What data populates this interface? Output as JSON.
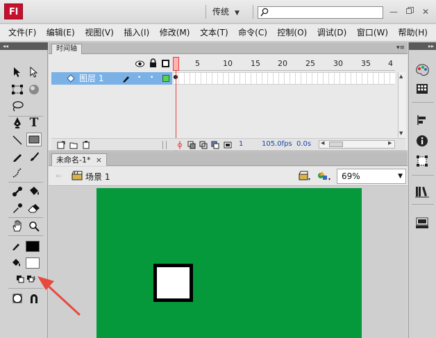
{
  "app": {
    "logo_text": "Fl",
    "workspace": "传统",
    "search": {
      "placeholder": "",
      "value": ""
    },
    "window_controls": [
      "minimize-icon",
      "restore-icon",
      "close-icon"
    ]
  },
  "menu": {
    "items": [
      {
        "label": "文件(F)"
      },
      {
        "label": "编辑(E)"
      },
      {
        "label": "视图(V)"
      },
      {
        "label": "插入(I)"
      },
      {
        "label": "修改(M)"
      },
      {
        "label": "文本(T)"
      },
      {
        "label": "命令(C)"
      },
      {
        "label": "控制(O)"
      },
      {
        "label": "调试(D)"
      },
      {
        "label": "窗口(W)"
      },
      {
        "label": "帮助(H)"
      }
    ]
  },
  "timeline": {
    "tab_label": "时间轴",
    "layer": {
      "name": "图层 1"
    },
    "frame_numbers": [
      "1",
      "5",
      "10",
      "15",
      "20",
      "25",
      "30",
      "35",
      "4"
    ],
    "current_frame": "1",
    "fps": "105.0fps",
    "elapsed": "0.0s"
  },
  "document": {
    "tab_title": "未命名-1*",
    "close_glyph": "×",
    "scene": "场景 1",
    "zoom": "69%"
  },
  "stage": {
    "background_color": "#05993b",
    "shape": {
      "fill": "#ffffff",
      "stroke": "#000000"
    }
  },
  "colors": {
    "stroke_color": "#000000",
    "fill_color": "#ffffff",
    "annotation_arrow": "#e8493f"
  }
}
